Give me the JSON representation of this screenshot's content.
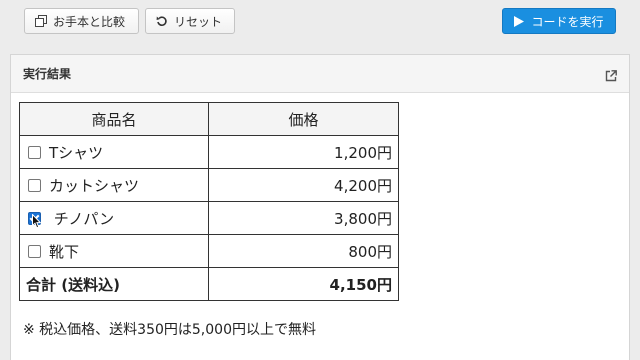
{
  "toolbar": {
    "compare_label": "お手本と比較",
    "reset_label": "リセット",
    "run_label": "コードを実行"
  },
  "panel": {
    "title": "実行結果"
  },
  "table": {
    "headers": [
      "商品名",
      "価格"
    ],
    "rows": [
      {
        "name": "Tシャツ",
        "price": "1,200円",
        "checked": false
      },
      {
        "name": "カットシャツ",
        "price": "4,200円",
        "checked": false
      },
      {
        "name": "チノパン",
        "price": "3,800円",
        "checked": true
      },
      {
        "name": "靴下",
        "price": "800円",
        "checked": false
      }
    ],
    "total": {
      "label": "合計 (送料込)",
      "value": "4,150円"
    }
  },
  "note": "※ 税込価格、送料350円は5,000円以上で無料",
  "colors": {
    "run_button": "#1a8fe0",
    "checkbox_checked": "#1a73d6"
  }
}
